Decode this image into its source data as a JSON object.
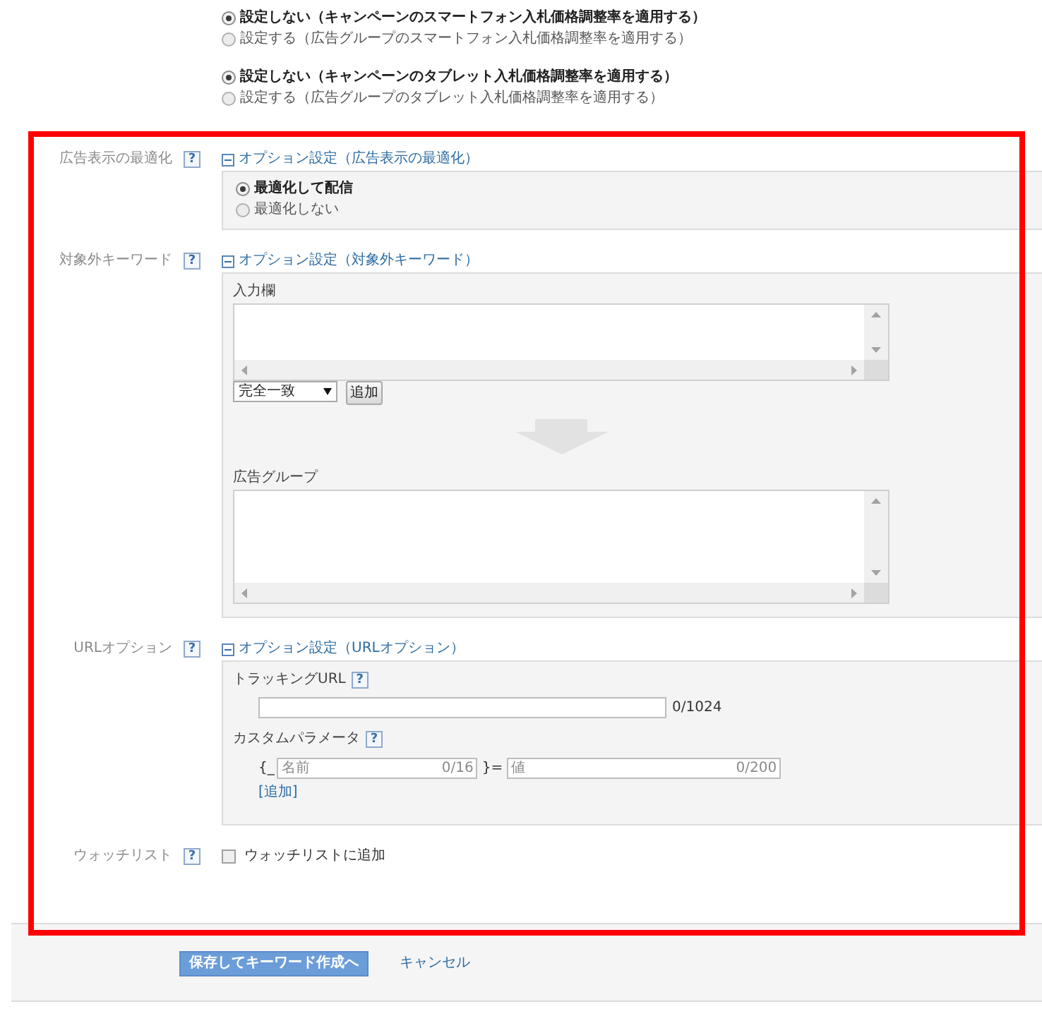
{
  "device_adjustments": [
    {
      "options": [
        {
          "label": "設定しない（キャンペーンのスマートフォン入札価格調整率を適用する）",
          "selected": true
        },
        {
          "label": "設定する（広告グループのスマートフォン入札価格調整率を適用する）",
          "selected": false
        }
      ]
    },
    {
      "options": [
        {
          "label": "設定しない（キャンペーンのタブレット入札価格調整率を適用する）",
          "selected": true
        },
        {
          "label": "設定する（広告グループのタブレット入札価格調整率を適用する）",
          "selected": false
        }
      ]
    }
  ],
  "sections": [
    {
      "kind": "radio",
      "label": "広告表示の最適化",
      "help": "?",
      "header": "オプション設定（広告表示の最適化）",
      "expanded": true,
      "options": [
        {
          "label": "最適化して配信",
          "selected": true
        },
        {
          "label": "最適化しない",
          "selected": false
        }
      ]
    },
    {
      "kind": "keywords",
      "label": "対象外キーワード",
      "help": "?",
      "header": "オプション設定（対象外キーワード）",
      "expanded": true,
      "input_label": "入力欄",
      "match_type": "完全一致",
      "add_button": "追加",
      "target_label": "広告グループ"
    },
    {
      "kind": "url",
      "label": "URLオプション",
      "help": "?",
      "header": "オプション設定（URLオプション）",
      "expanded": true,
      "tracking_url": {
        "label": "トラッキングURL",
        "help": "?",
        "counter": "0/1024"
      },
      "custom_parameter": {
        "label": "カスタムパラメータ",
        "help": "?",
        "prefix": "{_",
        "name_placeholder": "名前",
        "name_counter": "0/16",
        "separator": "}=",
        "value_placeholder": "値",
        "value_counter": "0/200",
        "add_link": "[追加]"
      }
    },
    {
      "kind": "checkbox",
      "label": "ウォッチリスト",
      "help": "?",
      "checkbox_label": "ウォッチリストに追加",
      "checked": false
    }
  ],
  "footer": {
    "save_button": "保存してキーワード作成へ",
    "cancel_link": "キャンセル"
  }
}
